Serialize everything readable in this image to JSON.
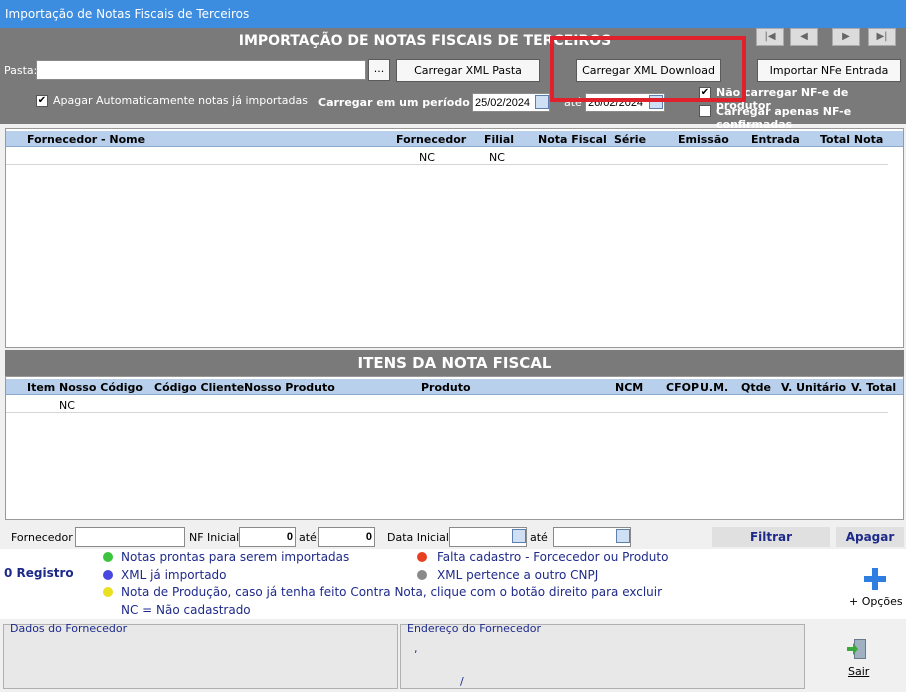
{
  "window": {
    "title": "Importação de Notas Fiscais de Terceiros"
  },
  "header": {
    "title": "IMPORTAÇÃO DE NOTAS FISCAIS DE TERCEIROS",
    "nav": [
      "|◀",
      "◀",
      "▶",
      "▶|"
    ]
  },
  "toolbar": {
    "pasta_label": "Pasta:",
    "pasta_value": "",
    "browse_label": "...",
    "btn_carregar_pasta": "Carregar XML Pasta",
    "btn_carregar_download": "Carregar XML Download",
    "btn_importar": "Importar NFe Entrada",
    "chk_apagar": "Apagar Automaticamente notas já importadas",
    "chk_apagar_checked": true,
    "periodo_label": "Carregar em um período de:",
    "data_inicio": "25/02/2024",
    "ate_label": "até",
    "data_fim": "26/02/2024",
    "chk_nao_produtor": "Não carregar NF-e de produtor",
    "chk_nao_produtor_checked": true,
    "chk_confirmadas": "Carregar apenas NF-e confirmadas",
    "chk_confirmadas_checked": false
  },
  "notas_grid": {
    "columns": [
      "Fornecedor - Nome",
      "Fornecedor",
      "Filial",
      "Nota Fiscal",
      "Série",
      "Emissão",
      "Entrada",
      "Total Nota"
    ],
    "rows": [
      {
        "nome": "",
        "fornecedor": "NC",
        "filial": "NC",
        "nota": "",
        "serie": "",
        "emissao": "",
        "entrada": "",
        "total": ""
      }
    ]
  },
  "itens": {
    "title": "ITENS DA NOTA FISCAL",
    "columns": [
      "Item",
      "Nosso Código",
      "Código Cliente",
      "Nosso Produto",
      "Produto",
      "NCM",
      "CFOP",
      "U.M.",
      "Qtde",
      "V. Unitário",
      "V. Total"
    ],
    "rows": [
      {
        "item": "",
        "nosso_codigo": "NC"
      }
    ]
  },
  "filter": {
    "fornecedor_label": "Fornecedor",
    "fornecedor_value": "",
    "nf_inicial_label": "NF Inicial",
    "nf_inicial_value": "0",
    "ate1_label": "até",
    "nf_final_value": "0",
    "data_inicial_label": "Data Inicial",
    "data_inicial_value": "",
    "ate2_label": "até",
    "data_final_value": "",
    "btn_filtrar": "Filtrar",
    "btn_apagar": "Apagar"
  },
  "legend": {
    "registros": "0 Registro",
    "items": [
      {
        "text": "Notas prontas para serem importadas",
        "color": "#3cc43c"
      },
      {
        "text": "XML já importado",
        "color": "#4848e0"
      },
      {
        "text": "Nota de Produção, caso já tenha feito Contra Nota, clique com o botão direito para excluir",
        "color": "#e8e020"
      },
      {
        "text": "Falta cadastro - Forcecedor ou Produto",
        "color": "#e84020"
      },
      {
        "text": "XML pertence a outro CNPJ",
        "color": "#8a8a8a"
      }
    ],
    "nc_note": "NC = Não cadastrado"
  },
  "opcoes": {
    "label": "+ Opções",
    "icon": "plus-icon"
  },
  "fornecedor_box": {
    "title": "Dados do Fornecedor"
  },
  "endereco_box": {
    "title": "Endereço do Fornecedor",
    "line1": ",",
    "line2": "/"
  },
  "sair": {
    "label": "Sair",
    "icon": "exit-door-icon"
  }
}
